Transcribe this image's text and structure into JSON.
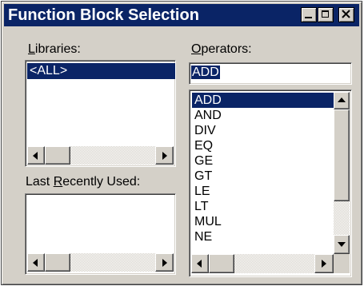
{
  "window": {
    "title": "Function Block Selection"
  },
  "libraries": {
    "label_pre": "",
    "label_accel": "L",
    "label_post": "ibraries:",
    "items": [
      "<ALL>"
    ],
    "selected_index": 0
  },
  "operators": {
    "label_pre": "",
    "label_accel": "O",
    "label_post": "perators:",
    "input_value": "ADD",
    "items": [
      "ADD",
      "AND",
      "DIV",
      "EQ",
      "GE",
      "GT",
      "LE",
      "LT",
      "MUL",
      "NE"
    ],
    "selected_index": 0
  },
  "recent": {
    "label_pre": "Last ",
    "label_accel": "R",
    "label_post": "ecently Used:",
    "items": []
  },
  "icons": {
    "minimize": "minimize-icon",
    "maximize": "maximize-icon",
    "close": "close-icon",
    "left": "arrow-left-icon",
    "right": "arrow-right-icon",
    "up": "arrow-up-icon",
    "down": "arrow-down-icon"
  },
  "colors": {
    "titlebar": "#0a2466",
    "face": "#d4d0c8",
    "selection": "#0a2466"
  }
}
